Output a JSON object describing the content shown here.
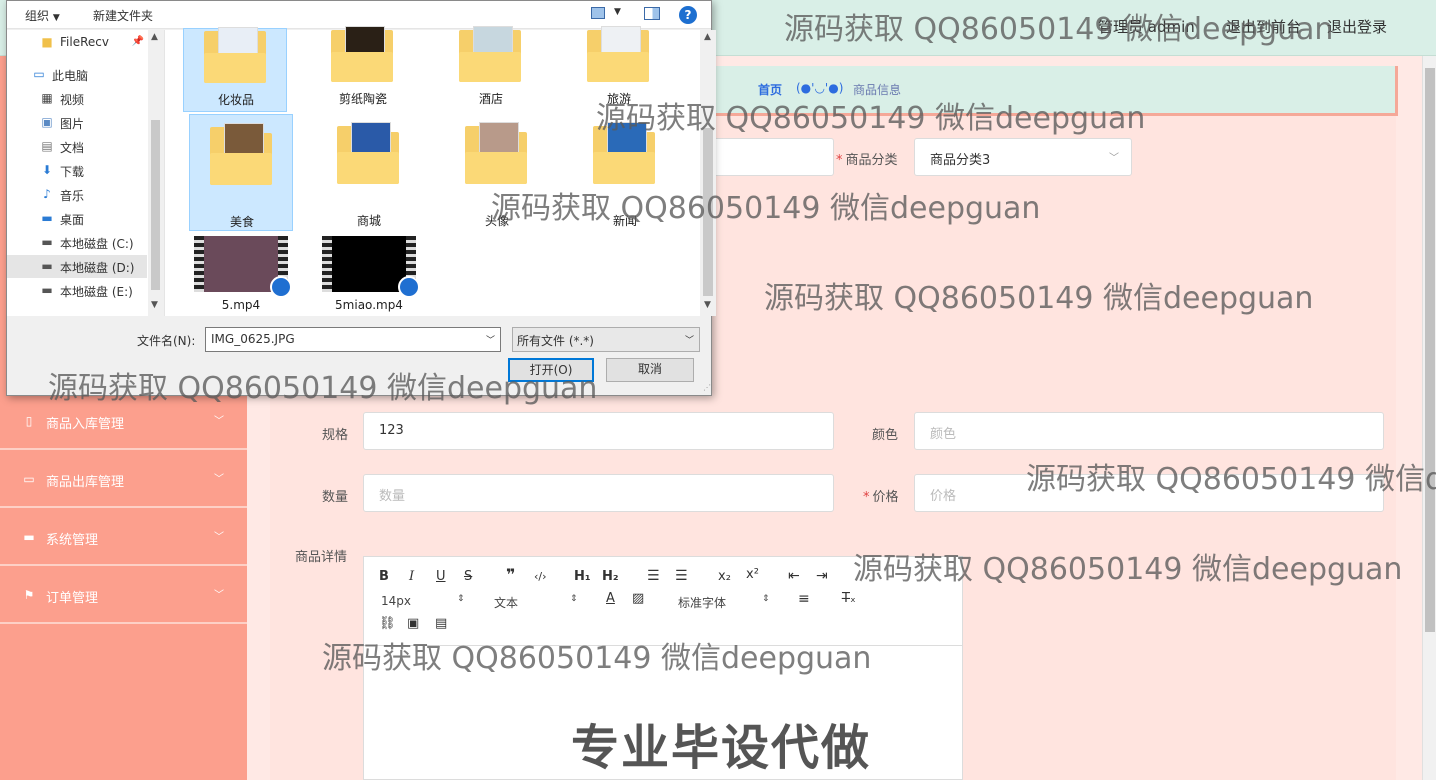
{
  "topbar": {
    "user": "管理员 admin",
    "front": "退出到前台",
    "logout": "退出登录"
  },
  "breadcrumb": {
    "home": "首页",
    "face": "(●'◡'●)",
    "current": "商品信息"
  },
  "sidebar": {
    "items": [
      {
        "label": "商品入库管理",
        "icon": "document-icon"
      },
      {
        "label": "商品出库管理",
        "icon": "chat-icon"
      },
      {
        "label": "系统管理",
        "icon": "monitor-icon"
      },
      {
        "label": "订单管理",
        "icon": "flag-icon"
      }
    ]
  },
  "form": {
    "category_label": "商品分类",
    "category_value": "商品分类3",
    "spec_label": "规格",
    "spec_value": "123",
    "color_label": "颜色",
    "color_placeholder": "颜色",
    "qty_label": "数量",
    "qty_placeholder": "数量",
    "price_label": "价格",
    "price_placeholder": "价格",
    "detail_label": "商品详情",
    "required_mark": "*"
  },
  "editor": {
    "font_size": "14px",
    "format": "文本",
    "font_family": "标准字体"
  },
  "dialog": {
    "organize": "组织",
    "new_folder": "新建文件夹",
    "nav": [
      {
        "label": "FileRecv",
        "icon": "folder-icon"
      },
      {
        "label": "此电脑",
        "icon": "computer-icon"
      },
      {
        "label": "视频",
        "icon": "video-icon"
      },
      {
        "label": "图片",
        "icon": "picture-icon"
      },
      {
        "label": "文档",
        "icon": "document-icon"
      },
      {
        "label": "下载",
        "icon": "download-icon"
      },
      {
        "label": "音乐",
        "icon": "music-icon"
      },
      {
        "label": "桌面",
        "icon": "desktop-icon"
      },
      {
        "label": "本地磁盘 (C:)",
        "icon": "drive-icon"
      },
      {
        "label": "本地磁盘 (D:)",
        "icon": "drive-icon"
      },
      {
        "label": "本地磁盘 (E:)",
        "icon": "drive-icon"
      }
    ],
    "files": [
      {
        "name": "化妆品",
        "kind": "folder",
        "color": "#e8eef6"
      },
      {
        "name": "剪纸陶瓷",
        "kind": "folder",
        "color": "#2a2016"
      },
      {
        "name": "酒店",
        "kind": "folder",
        "color": "#c7d7df"
      },
      {
        "name": "旅游",
        "kind": "folder",
        "color": "#eef1f4"
      },
      {
        "name": "美食",
        "kind": "folder",
        "color": "#7a5a3a"
      },
      {
        "name": "商城",
        "kind": "folder",
        "color": "#2a5aa8"
      },
      {
        "name": "头像",
        "kind": "folder",
        "color": "#b89a8a"
      },
      {
        "name": "新闻",
        "kind": "folder",
        "color": "#2a6ab8"
      },
      {
        "name": "5.mp4",
        "kind": "video",
        "color": "#6a4a5a"
      },
      {
        "name": "5miao.mp4",
        "kind": "video",
        "color": "#000000"
      }
    ],
    "filename_label": "文件名(N):",
    "filename_value": "IMG_0625.JPG",
    "filetype": "所有文件 (*.*)",
    "open_button": "打开(O)",
    "cancel_button": "取消",
    "help": "?"
  },
  "watermarks": [
    "源码获取 QQ86050149 微信deepguan",
    "源码获取 QQ86050149 微信deepguan",
    "源码获取 QQ86050149 微信deepguan",
    "源码获取 QQ86050149 微信deepguan",
    "源码获取 QQ86050149 微信deepguan",
    "源码获取 QQ86050149 微信d",
    "源码获取 QQ86050149 微信deepguan",
    "源码获取 QQ86050149 微信deepguan"
  ],
  "banner": "专业毕设代做"
}
